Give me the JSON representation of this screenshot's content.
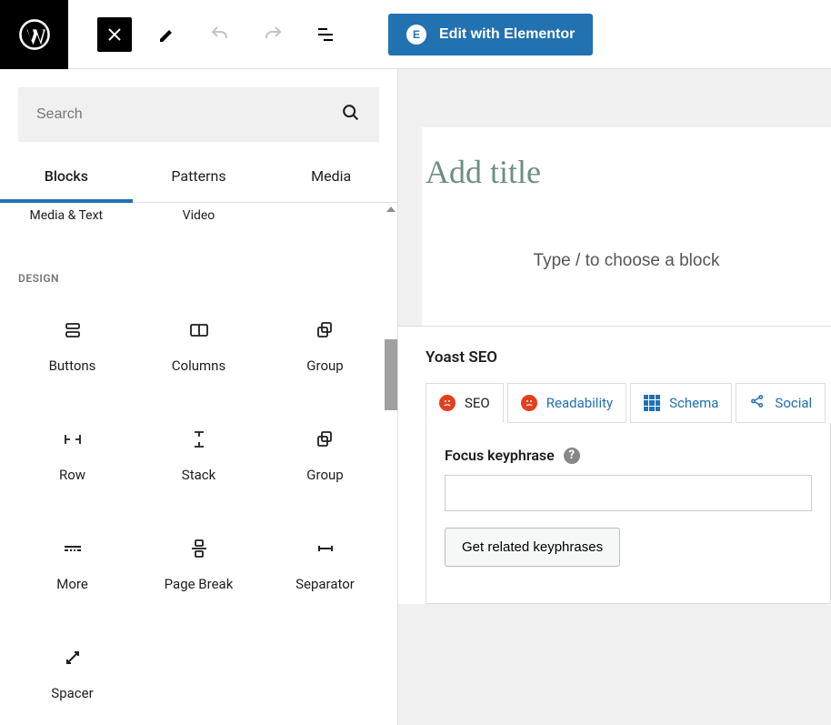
{
  "toolbar": {
    "elementor_label": "Edit with Elementor"
  },
  "inserter": {
    "search_placeholder": "Search",
    "tabs": {
      "blocks": "Blocks",
      "patterns": "Patterns",
      "media": "Media"
    },
    "prev_row": [
      "Media & Text",
      "Video",
      ""
    ],
    "category": "DESIGN",
    "blocks": [
      "Buttons",
      "Columns",
      "Group",
      "Row",
      "Stack",
      "Group",
      "More",
      "Page Break",
      "Separator",
      "Spacer"
    ]
  },
  "editor": {
    "title_placeholder": "Add title",
    "body_placeholder": "Type / to choose a block"
  },
  "yoast": {
    "heading": "Yoast SEO",
    "tabs": {
      "seo": "SEO",
      "readability": "Readability",
      "schema": "Schema",
      "social": "Social"
    },
    "focus_label": "Focus keyphrase",
    "related_btn": "Get related keyphrases"
  }
}
